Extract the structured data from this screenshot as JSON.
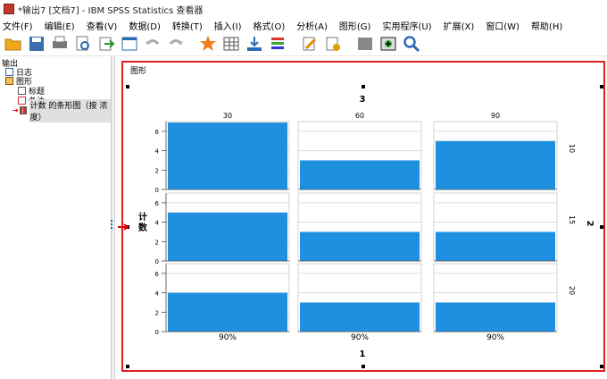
{
  "window": {
    "title": "*输出7 [文档7] - IBM SPSS Statistics 查看器"
  },
  "menu": {
    "items": [
      "文件(F)",
      "编辑(E)",
      "查看(V)",
      "数据(D)",
      "转换(T)",
      "插入(I)",
      "格式(O)",
      "分析(A)",
      "图形(G)",
      "实用程序(U)",
      "扩展(X)",
      "窗口(W)",
      "帮助(H)"
    ]
  },
  "toolbar": {
    "icons": [
      "open-folder-icon",
      "save-icon",
      "print-icon",
      "print-preview-icon",
      "export-icon",
      "recall-dialog-icon",
      "undo-icon",
      "redo-icon",
      "star-icon",
      "go-to-data-icon",
      "insert-variable-icon",
      "designate-window-icon",
      "edit-icon",
      "syntax-icon",
      "hide-icon",
      "insert-object-icon",
      "search-icon"
    ]
  },
  "nav": {
    "root": "输出",
    "items": [
      {
        "label": "日志"
      },
      {
        "label": "图形"
      },
      {
        "label": "标题"
      },
      {
        "label": "备注"
      },
      {
        "label": "计数 的条形图（按 浓度）"
      }
    ]
  },
  "content": {
    "section_label": "图形"
  },
  "chart_data": {
    "type": "bar",
    "column_title": "3",
    "row_title": "2",
    "x_bottom_title": "1",
    "ylabel": "计\n数",
    "columns": [
      "30",
      "60",
      "90"
    ],
    "rows": [
      "10",
      "15",
      "20"
    ],
    "category": "90%",
    "ylim": [
      0,
      7
    ],
    "yticks": [
      "0",
      "2",
      "4",
      "6"
    ],
    "grid": true,
    "bar_color": "#1f8fe0",
    "values": [
      [
        6.9,
        3.0,
        5.0
      ],
      [
        5.0,
        3.0,
        3.0
      ],
      [
        4.0,
        3.0,
        3.0
      ]
    ]
  }
}
